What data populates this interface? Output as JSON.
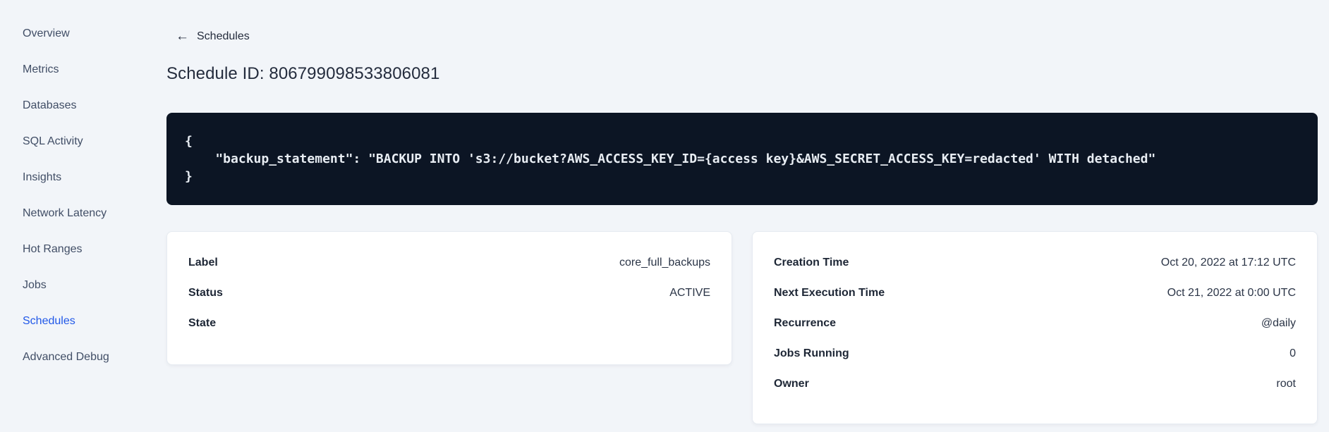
{
  "colors": {
    "page_background": "#f2f5f9",
    "code_background": "#0c1524",
    "accent_blue": "#2158e8"
  },
  "icons": {
    "back_arrow": "←"
  },
  "sidebar": {
    "items": [
      {
        "label": "Overview",
        "active": false
      },
      {
        "label": "Metrics",
        "active": false
      },
      {
        "label": "Databases",
        "active": false
      },
      {
        "label": "SQL Activity",
        "active": false
      },
      {
        "label": "Insights",
        "active": false
      },
      {
        "label": "Network Latency",
        "active": false
      },
      {
        "label": "Hot Ranges",
        "active": false
      },
      {
        "label": "Jobs",
        "active": false
      },
      {
        "label": "Schedules",
        "active": true
      },
      {
        "label": "Advanced Debug",
        "active": false
      }
    ]
  },
  "header": {
    "back_label": "Schedules",
    "title": "Schedule ID: 806799098533806081"
  },
  "code": {
    "lines": [
      "{",
      "    \"backup_statement\": \"BACKUP INTO 's3://bucket?AWS_ACCESS_KEY_ID={access key}&AWS_SECRET_ACCESS_KEY=redacted' WITH detached\"",
      "}"
    ]
  },
  "details_card": {
    "rows": [
      {
        "label": "Label",
        "value": "core_full_backups"
      },
      {
        "label": "Status",
        "value": "ACTIVE"
      },
      {
        "label": "State",
        "value": ""
      }
    ]
  },
  "timing_card": {
    "rows": [
      {
        "label": "Creation Time",
        "value": "Oct 20, 2022 at 17:12 UTC"
      },
      {
        "label": "Next Execution Time",
        "value": "Oct 21, 2022 at 0:00 UTC"
      },
      {
        "label": "Recurrence",
        "value": "@daily"
      },
      {
        "label": "Jobs Running",
        "value": "0"
      },
      {
        "label": "Owner",
        "value": "root"
      }
    ]
  }
}
